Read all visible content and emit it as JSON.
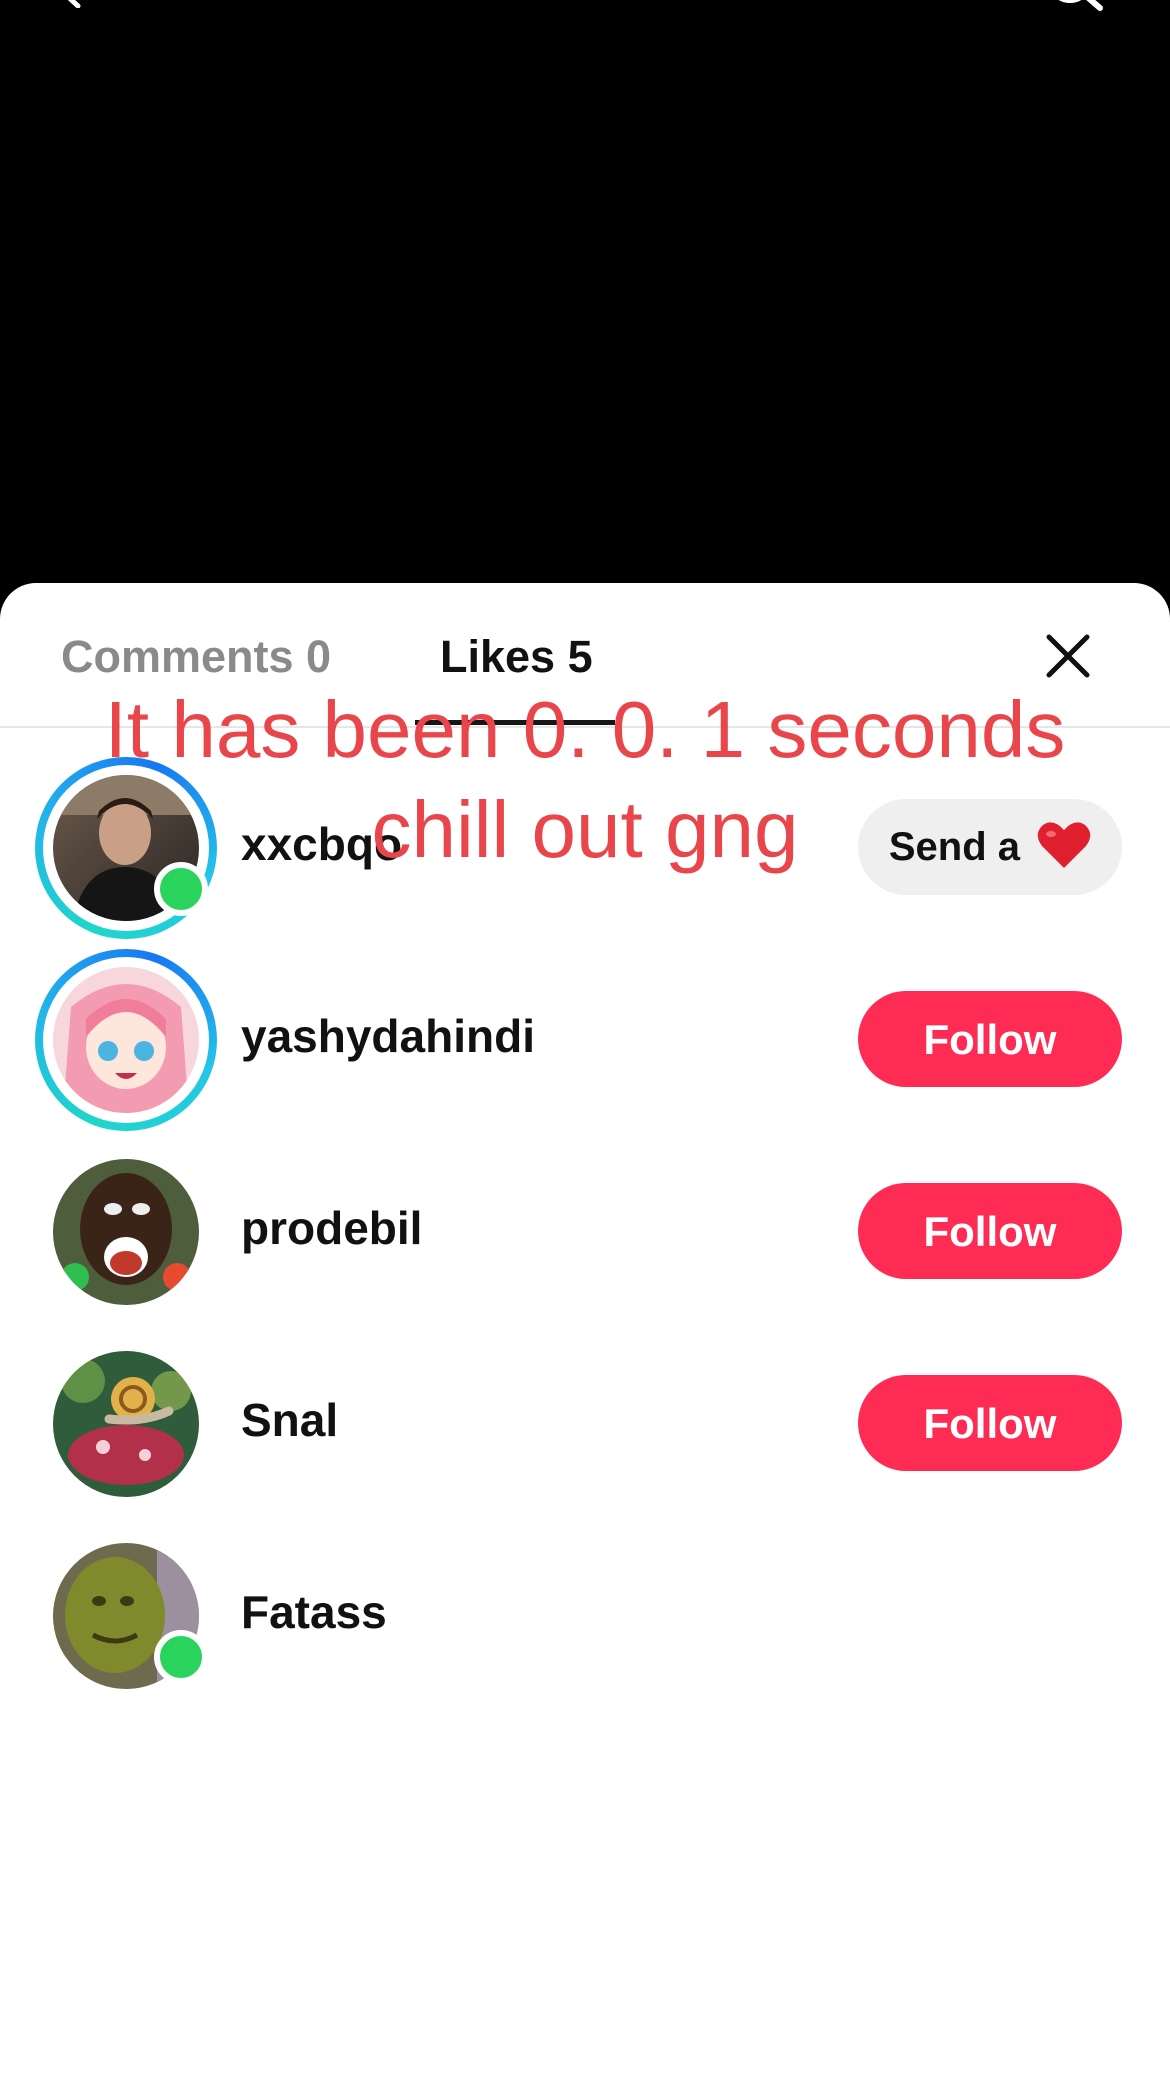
{
  "tabs": {
    "comments_label": "Comments 0",
    "likes_label": "Likes 5"
  },
  "overlay_caption": {
    "line1": "It has been 0. 0. 1 seconds",
    "line2": "chill out gng"
  },
  "likes": [
    {
      "username": "xxcbqo",
      "action": "Send a",
      "action_icon": "heart-icon",
      "online": true,
      "story_ring": true
    },
    {
      "username": "yashydahindi",
      "action": "Follow",
      "online": false,
      "story_ring": true
    },
    {
      "username": "prodebil",
      "action": "Follow",
      "online": false,
      "story_ring": false
    },
    {
      "username": "Snal",
      "action": "Follow",
      "online": false,
      "story_ring": false
    },
    {
      "username": "Fatass",
      "action": "",
      "online": true,
      "story_ring": false
    }
  ],
  "colors": {
    "follow": "#fe2c55",
    "online": "#2ad35c",
    "caption": "#e8464a"
  }
}
